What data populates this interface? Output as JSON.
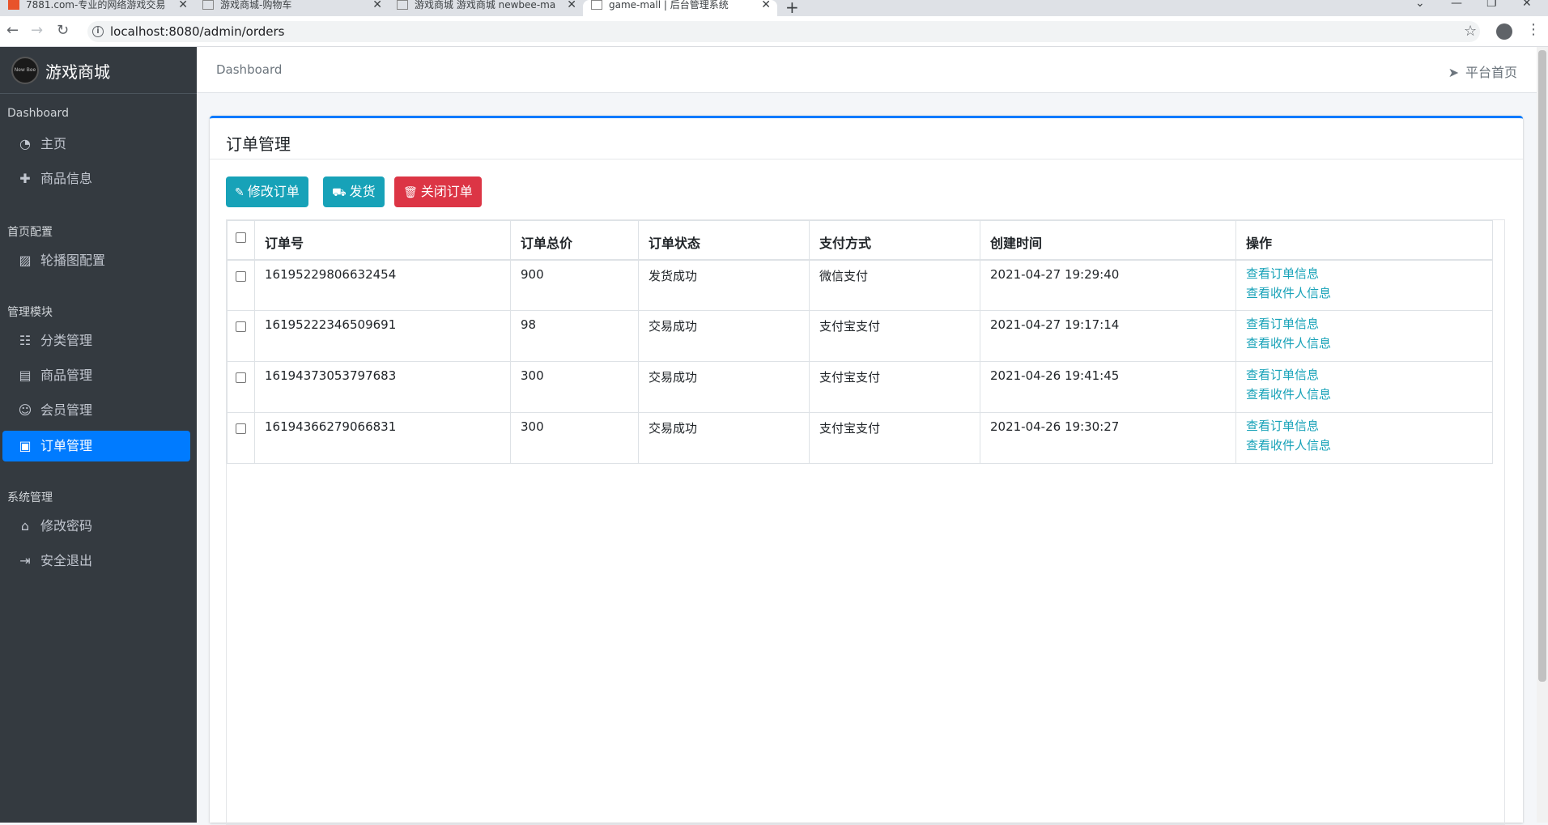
{
  "browser": {
    "tabs": [
      {
        "title": "7881.com-专业的网络游戏交易"
      },
      {
        "title": "游戏商城-购物车"
      },
      {
        "title": "游戏商城 游戏商城 newbee-ma"
      },
      {
        "title": "game-mall | 后台管理系统"
      }
    ],
    "url": "localhost:8080/admin/orders"
  },
  "sidebar": {
    "brand": "游戏商城",
    "logo_text": "New Bee",
    "sections": [
      {
        "header": "Dashboard",
        "items": [
          {
            "label": "主页",
            "icon": "dashboard-icon"
          },
          {
            "label": "商品信息",
            "icon": "plus-icon"
          }
        ]
      },
      {
        "header": "首页配置",
        "items": [
          {
            "label": "轮播图配置",
            "icon": "image-icon"
          }
        ]
      },
      {
        "header": "管理模块",
        "items": [
          {
            "label": "分类管理",
            "icon": "list-icon"
          },
          {
            "label": "商品管理",
            "icon": "archive-icon"
          },
          {
            "label": "会员管理",
            "icon": "users-icon"
          },
          {
            "label": "订单管理",
            "icon": "money-icon",
            "active": true
          }
        ]
      },
      {
        "header": "系统管理",
        "items": [
          {
            "label": "修改密码",
            "icon": "lock-icon"
          },
          {
            "label": "安全退出",
            "icon": "sign-out-icon"
          }
        ]
      }
    ]
  },
  "topbar": {
    "breadcrumb": "Dashboard",
    "home_link": "平台首页"
  },
  "card": {
    "title": "订单管理",
    "buttons": {
      "edit": "修改订单",
      "ship": "发货",
      "close": "关闭订单"
    }
  },
  "table": {
    "headers": [
      "订单号",
      "订单总价",
      "订单状态",
      "支付方式",
      "创建时间",
      "操作"
    ],
    "rows": [
      {
        "order_no": "16195229806632454",
        "total": "900",
        "status": "发货成功",
        "pay": "微信支付",
        "created": "2021-04-27 19:29:40"
      },
      {
        "order_no": "16195222346509691",
        "total": "98",
        "status": "交易成功",
        "pay": "支付宝支付",
        "created": "2021-04-27 19:17:14"
      },
      {
        "order_no": "16194373053797683",
        "total": "300",
        "status": "交易成功",
        "pay": "支付宝支付",
        "created": "2021-04-26 19:41:45"
      },
      {
        "order_no": "16194366279066831",
        "total": "300",
        "status": "交易成功",
        "pay": "支付宝支付",
        "created": "2021-04-26 19:30:27"
      }
    ],
    "actions": {
      "view_order": "查看订单信息",
      "view_receiver": "查看收件人信息"
    }
  },
  "colors": {
    "primary": "#007bff",
    "info": "#17a2b8",
    "danger": "#dc3545",
    "sidebar": "#343a40"
  }
}
